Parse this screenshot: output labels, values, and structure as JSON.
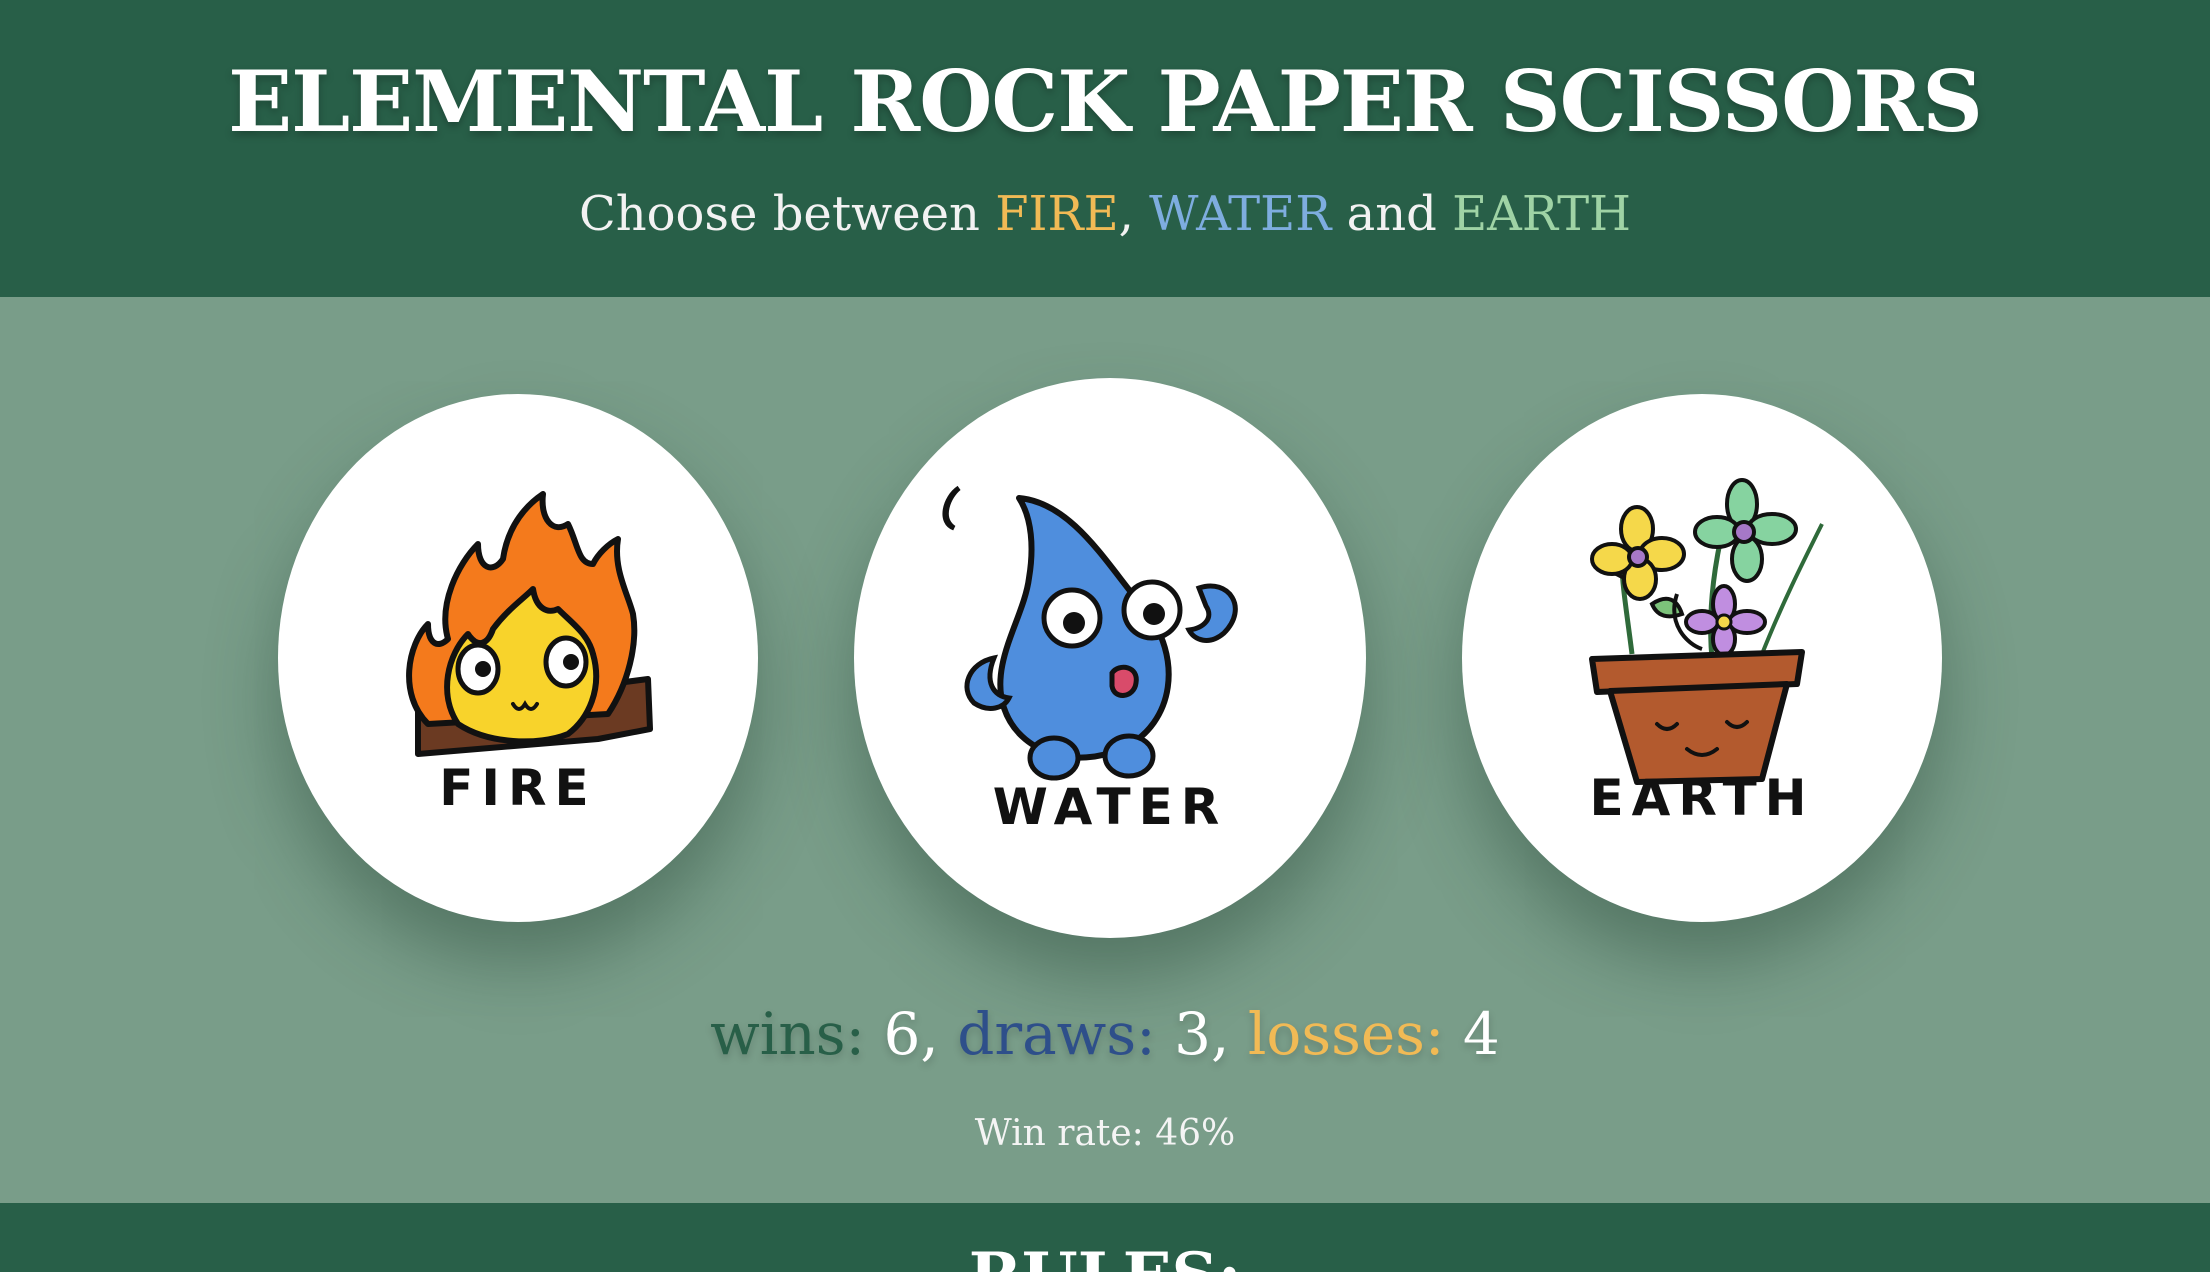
{
  "header": {
    "title": "ELEMENTAL ROCK PAPER SCISSORS",
    "subtitle_prefix": "Choose between ",
    "fire": "FIRE",
    "sep1": ", ",
    "water": "WATER",
    "sep2": " and ",
    "earth": "EARTH"
  },
  "choices": [
    {
      "id": "fire",
      "label": "FIRE",
      "icon": "fire-icon"
    },
    {
      "id": "water",
      "label": "WATER",
      "icon": "water-drop-icon"
    },
    {
      "id": "earth",
      "label": "EARTH",
      "icon": "flower-pot-icon"
    }
  ],
  "score": {
    "wins_label": "wins:",
    "wins": "6",
    "draws_label": "draws:",
    "draws": "3",
    "losses_label": "losses:",
    "losses": "4",
    "win_rate": "Win rate: 46%"
  },
  "rules": {
    "title": "RULES:"
  },
  "colors": {
    "header_bg": "#285f48",
    "body_bg": "#799d89",
    "fire": "#f1ba55",
    "water": "#7eaddf",
    "earth": "#9fd3a5",
    "wins": "#285f48",
    "draws": "#2e4f8a",
    "losses": "#f1ba55"
  }
}
